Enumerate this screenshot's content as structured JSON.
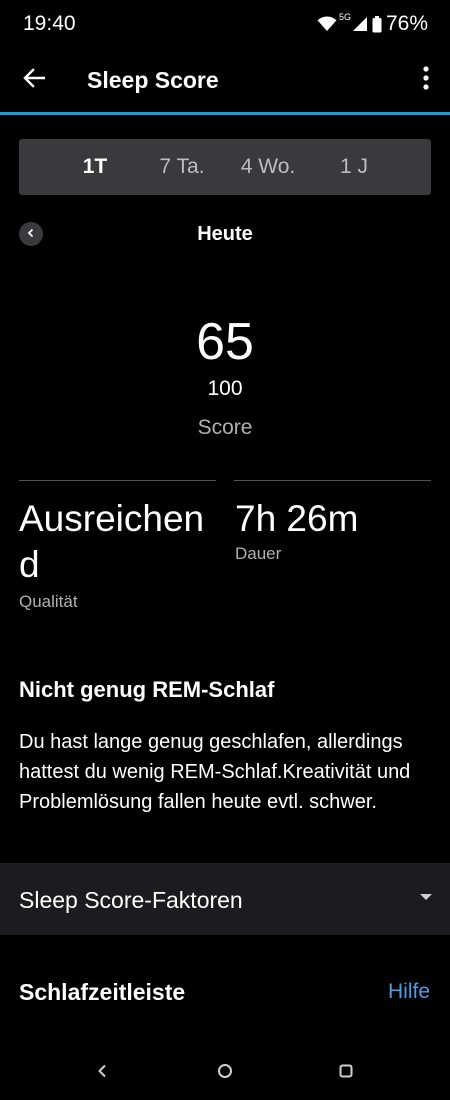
{
  "status_bar": {
    "time": "19:40",
    "network": "5G",
    "battery": "76%"
  },
  "app_bar": {
    "title": "Sleep Score",
    "accent_color": "#1f9ad9"
  },
  "period_tabs": [
    {
      "label": "1T",
      "active": true
    },
    {
      "label": "7 Ta.",
      "active": false
    },
    {
      "label": "4 Wo.",
      "active": false
    },
    {
      "label": "1 J",
      "active": false
    }
  ],
  "date_nav": {
    "label": "Heute"
  },
  "score": {
    "value": "65",
    "max": "100",
    "label": "Score"
  },
  "stats": {
    "quality": {
      "value": "Ausreichend",
      "label": "Qualität"
    },
    "duration": {
      "value": "7h 26m",
      "label": "Dauer"
    }
  },
  "insight": {
    "title": "Nicht genug REM-Schlaf",
    "body": "Du hast lange genug geschlafen, allerdings hattest du wenig REM-Schlaf.Kreativität und Problemlösung fallen heute evtl. schwer."
  },
  "factors": {
    "label": "Sleep Score-Faktoren"
  },
  "timeline": {
    "title": "Schlafzeitleiste",
    "help_label": "Hilfe",
    "help_color": "#4a9ee6"
  },
  "icons": {
    "back": "arrow-left-icon",
    "more": "more-vert-icon",
    "prev": "chevron-left-icon",
    "dropdown": "caret-down-icon"
  }
}
